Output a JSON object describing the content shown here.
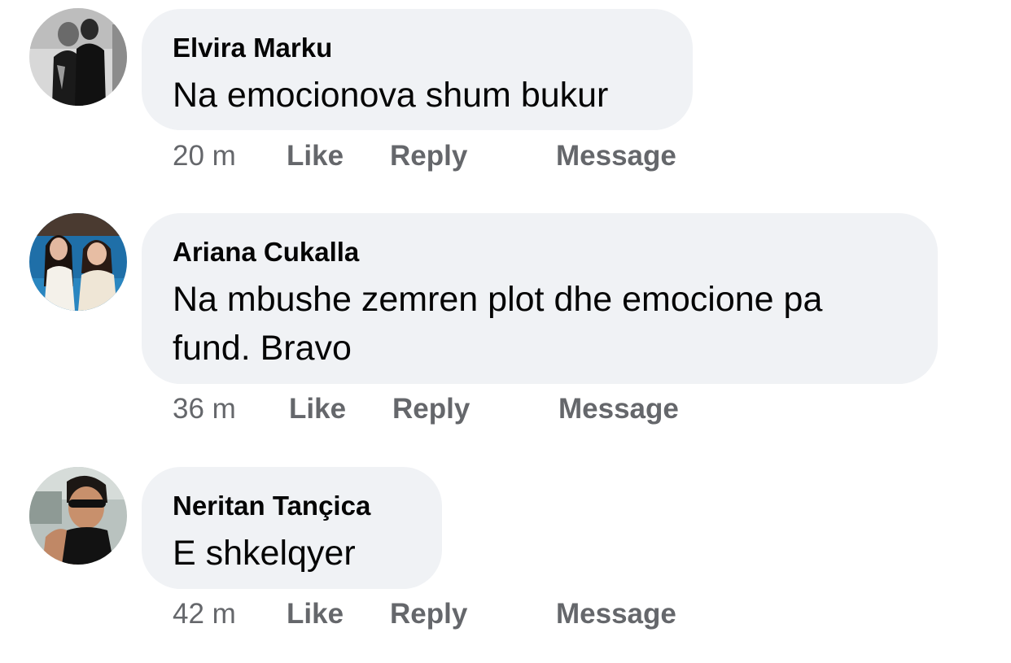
{
  "comments": [
    {
      "author": "Elvira Marku",
      "text": "Na emocionova shum bukur",
      "time": "20 m",
      "like_label": "Like",
      "reply_label": "Reply",
      "message_label": "Message"
    },
    {
      "author": "Ariana Cukalla",
      "text": "Na mbushe zemren plot dhe emocione pa fund. Bravo",
      "time": "36 m",
      "like_label": "Like",
      "reply_label": "Reply",
      "message_label": "Message"
    },
    {
      "author": "Neritan Tançica",
      "text": "E shkelqyer",
      "time": "42 m",
      "like_label": "Like",
      "reply_label": "Reply",
      "message_label": "Message"
    }
  ],
  "colors": {
    "bubble_bg": "#f0f2f5",
    "text_primary": "#050505",
    "text_secondary": "#65676b"
  }
}
